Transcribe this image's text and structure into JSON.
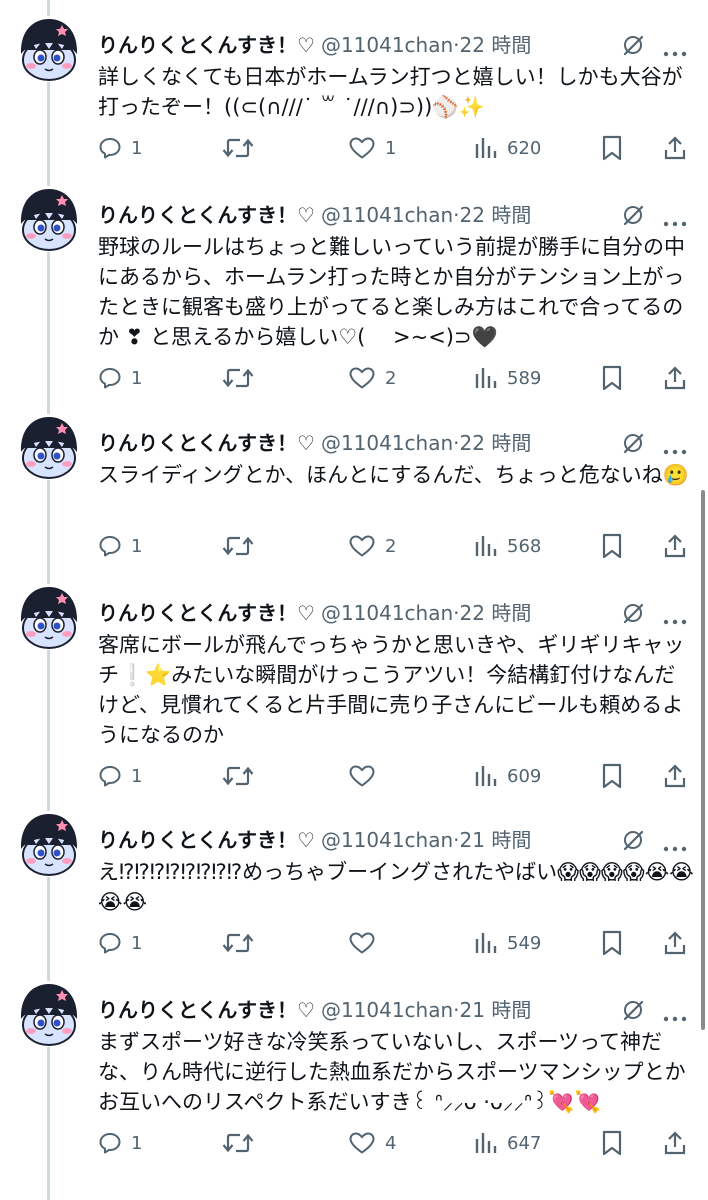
{
  "tweets": [
    {
      "name": "りんりくとくんすき！♡",
      "handle": "@11041chan",
      "dot": "·",
      "time": "22 時間",
      "text": "詳しくなくても日本がホームラン打つと嬉しい！しかも大谷が打ったぞー！((⊂(∩///˙ ꒳ ˙///∩)⊃))⚾✨",
      "replies": "1",
      "retweets": "",
      "likes": "1",
      "views": "620"
    },
    {
      "name": "りんりくとくんすき！♡",
      "handle": "@11041chan",
      "dot": "·",
      "time": "22 時間",
      "text": "野球のルールはちょっと難しいっていう前提が勝手に自分の中にあるから、ホームラン打った時とか自分がテンション上がったときに観客も盛り上がってると楽しみ方はこれで合ってるのか ❣ と思えるから嬉しい♡(　 >~<)⊃🖤",
      "replies": "1",
      "retweets": "",
      "likes": "2",
      "views": "589"
    },
    {
      "name": "りんりくとくんすき！♡",
      "handle": "@11041chan",
      "dot": "·",
      "time": "22 時間",
      "text": "スライディングとか、ほんとにするんだ、ちょっと危ないね🥲",
      "replies": "1",
      "retweets": "",
      "likes": "2",
      "views": "568"
    },
    {
      "name": "りんりくとくんすき！♡",
      "handle": "@11041chan",
      "dot": "·",
      "time": "22 時間",
      "text": "客席にボールが飛んでっちゃうかと思いきや、ギリギリキャッチ❕⭐みたいな瞬間がけっこうアツい！今結構釘付けなんだけど、見慣れてくると片手間に売り子さんにビールも頼めるようになるのか",
      "replies": "1",
      "retweets": "",
      "likes": "",
      "views": "609"
    },
    {
      "name": "りんりくとくんすき！♡",
      "handle": "@11041chan",
      "dot": "·",
      "time": "21 時間",
      "text": "え⁉⁉⁉⁉⁉⁉⁉⁉めっちゃブーイングされたやばい😱😱😱😱😭😭😭😭",
      "replies": "1",
      "retweets": "",
      "likes": "",
      "views": "549"
    },
    {
      "name": "りんりくとくんすき！♡",
      "handle": "@11041chan",
      "dot": "·",
      "time": "21 時間",
      "text": "まずスポーツ好きな冷笑系っていないし、スポーツって神だな、りん時代に逆行した熱血系だからスポーツマンシップとかお互いへのリスペクト系だいすき꒰ ᐢ⸝⸝ᴗ ·ᴗ⸝⸝ᐢ꒱💘💘",
      "replies": "1",
      "retweets": "",
      "likes": "4",
      "views": "647"
    }
  ],
  "icons": {
    "reply": "reply-bubble-icon",
    "retweet": "retweet-arrows-icon",
    "like": "heart-icon",
    "views": "views-bar-chart-icon",
    "bookmark": "bookmark-icon",
    "share": "share-upload-icon",
    "grok": "grok-icon",
    "more": "more-dots-icon"
  },
  "colors": {
    "text": "#0f1419",
    "secondary": "#536471",
    "thread_line": "#cfd9de",
    "avatar_hair": "#1b2030",
    "avatar_face": "#d8e4ff"
  }
}
